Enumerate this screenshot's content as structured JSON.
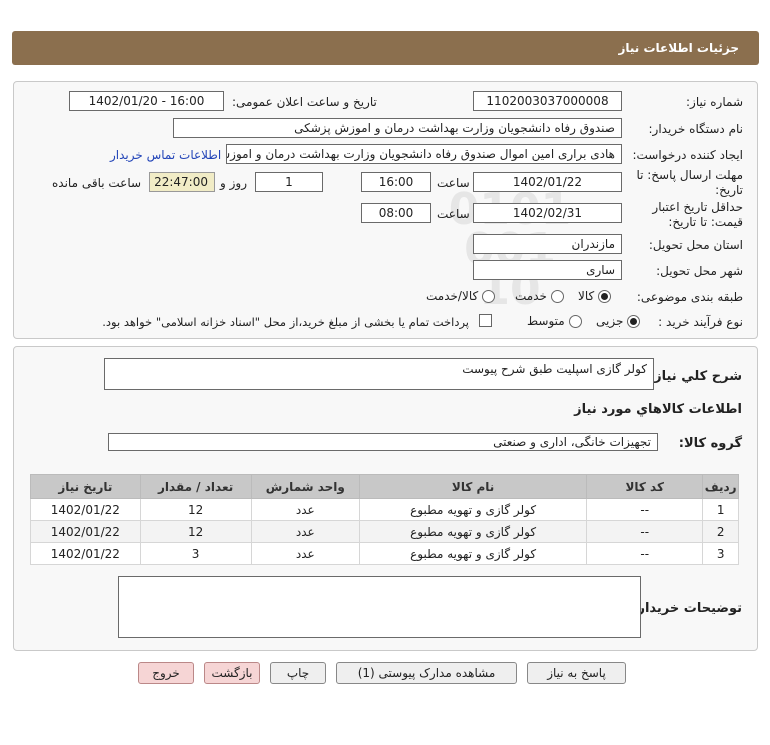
{
  "page": {
    "title": "جزئیات اطلاعات نیاز"
  },
  "info": {
    "need_number_label": "شماره نیاز:",
    "need_number": "1102003037000008",
    "announce_label": "تاریخ و ساعت اعلان عمومی:",
    "announce_value": "1402/01/20 - 16:00",
    "buyer_org_label": "نام دستگاه خریدار:",
    "buyer_org": "صندوق رفاه دانشجویان وزارت بهداشت  درمان و اموزش پزشکی",
    "creator_label": "ایجاد کننده درخواست:",
    "creator": "هادی براری امین اموال صندوق رفاه دانشجویان وزارت بهداشت  درمان و اموزش پزشکی",
    "contact_link": "اطلاعات تماس خریدار",
    "deadline_label_1": "مهلت ارسال پاسخ: تا",
    "deadline_label_2": "تاریخ:",
    "deadline_date": "1402/01/22",
    "time_label": "ساعت",
    "deadline_time": "16:00",
    "days_value": "1",
    "days_label": "روز و",
    "remaining_time": "22:47:00",
    "remaining_label": "ساعت باقی مانده",
    "validity_label_1": "حداقل تاریخ اعتبار",
    "validity_label_2": "قیمت: تا تاریخ:",
    "validity_date": "1402/02/31",
    "validity_time_label": "ساعت",
    "validity_time": "08:00",
    "province_label": "استان محل تحویل:",
    "province": "مازندران",
    "city_label": "شهر محل تحویل:",
    "city": "ساری",
    "category_label": "طبقه بندی موضوعی:",
    "category_options": [
      "کالا",
      "خدمت",
      "کالا/خدمت"
    ],
    "purchase_type_label": "نوع فرآیند خرید :",
    "purchase_options": [
      "جزیی",
      "متوسط"
    ],
    "payment_note": "پرداخت تمام یا بخشی از مبلغ خرید،از محل \"اسناد خزانه اسلامی\" خواهد بود."
  },
  "goods": {
    "summary_label": "شرح کلي نیاز:",
    "summary": "کولر گازی اسپلیت طبق شرح پیوست",
    "section_title": "اطلاعات کالاهاي مورد نیاز",
    "group_label": "گروه کالا:",
    "group": "تجهیزات خانگی، اداری و صنعتی",
    "table": {
      "headers": [
        "ردیف",
        "کد کالا",
        "نام کالا",
        "واحد شمارش",
        "تعداد / مقدار",
        "تاریخ نیاز"
      ],
      "rows": [
        [
          "1",
          "--",
          "کولر گازی و تهویه مطبوع",
          "عدد",
          "12",
          "1402/01/22"
        ],
        [
          "2",
          "--",
          "کولر گازی و تهویه مطبوع",
          "عدد",
          "12",
          "1402/01/22"
        ],
        [
          "3",
          "--",
          "کولر گازی و تهویه مطبوع",
          "عدد",
          "3",
          "1402/01/22"
        ]
      ]
    },
    "buyer_notes_label": "توضیحات خریدار:",
    "buyer_notes": ""
  },
  "buttons": {
    "reply": "پاسخ به نیاز",
    "attachments": "مشاهده مدارک پیوستی (1)",
    "print": "چاپ",
    "back": "بازگشت",
    "exit": "خروج"
  },
  "watermark": {
    "brand": "ParsNamadData",
    "tagline_1": "پایگاه اطلاع رسانی مناقصه ایران",
    "tagline_2": "پارس نماد داده ها",
    "phone": "۰۲۱-۸۸۳۴۹۶۷۰-۵",
    "code": "0101 001 10"
  }
}
